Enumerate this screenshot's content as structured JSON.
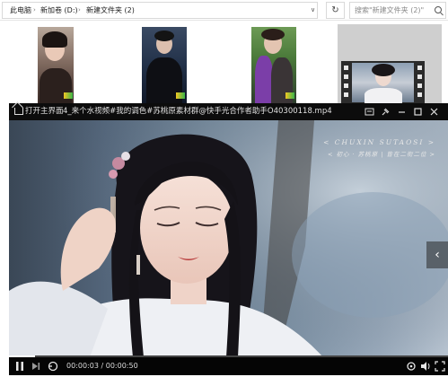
{
  "explorer": {
    "breadcrumbs": [
      "此电脑",
      "新加卷 (D:)",
      "新建文件夹 (2)"
    ],
    "search_placeholder": "搜索\"新建文件夹 (2)\""
  },
  "player": {
    "back_label": "打开主界面",
    "file_title": "4_来个水视频#我的调色#苏桃原素材群@快手光合作者助手O40300118.mp4",
    "watermark_line1": "< CHUXIN SUTAOSI >",
    "watermark_line2": "< 初心 · 苏桃原 | 皆在二衔二位 >",
    "time_current": "00:00:03",
    "time_separator": "/",
    "time_total": "00:00:50",
    "progress_fraction": 0.06
  },
  "icons": {
    "home": "home-icon",
    "pin": "pin-icon",
    "minimize": "minimize-icon",
    "maximize": "maximize-icon",
    "close": "close-icon",
    "screenshot": "screen-capture-icon",
    "pause": "pause-icon",
    "next": "next-track-icon",
    "loop": "loop-icon",
    "settings": "settings-icon",
    "volume": "volume-icon",
    "fullscreen": "fullscreen-icon",
    "chevron_right": "chevron-right-icon"
  }
}
